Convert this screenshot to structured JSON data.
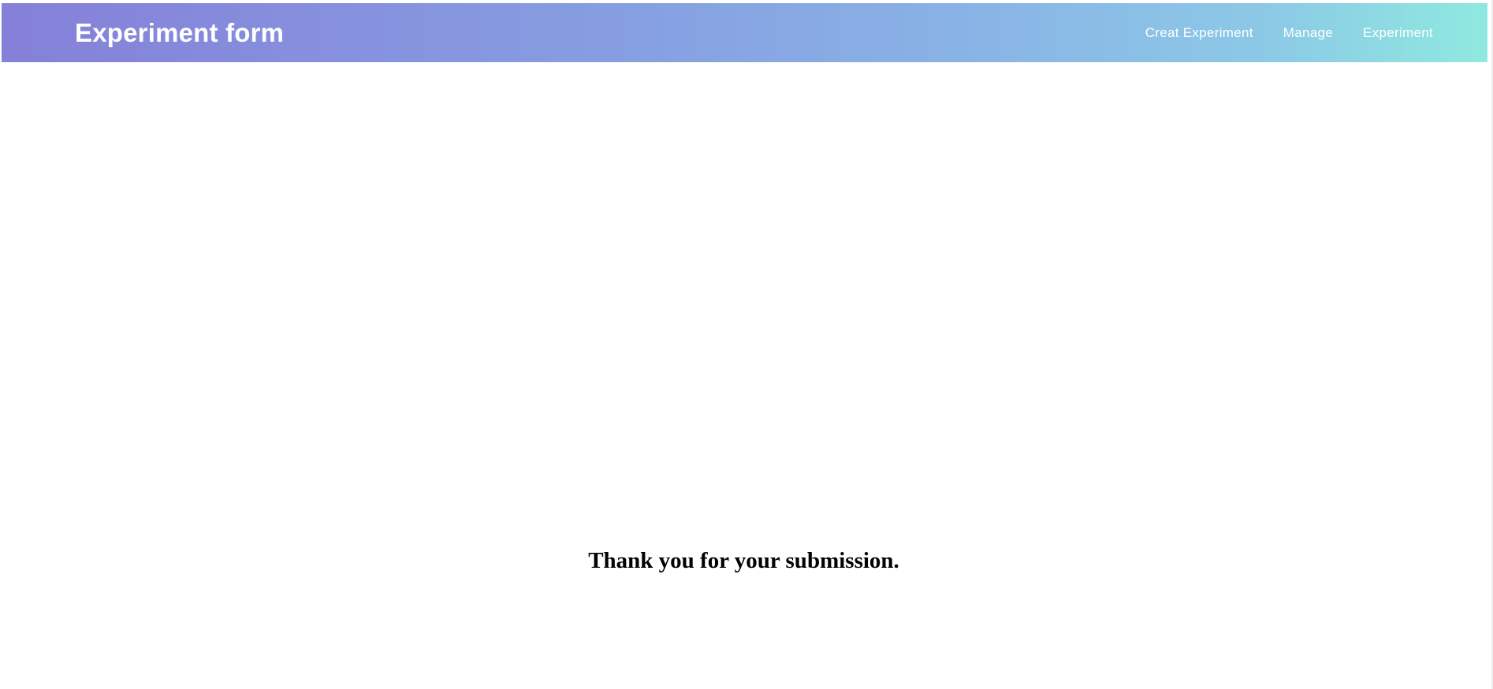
{
  "header": {
    "title": "Experiment form",
    "nav": [
      {
        "label": "Creat Experiment"
      },
      {
        "label": "Manage"
      },
      {
        "label": "Experiment"
      }
    ],
    "gradient_start": "#8580d9",
    "gradient_end": "#8fe9e0"
  },
  "main": {
    "message": "Thank you for your submission."
  }
}
